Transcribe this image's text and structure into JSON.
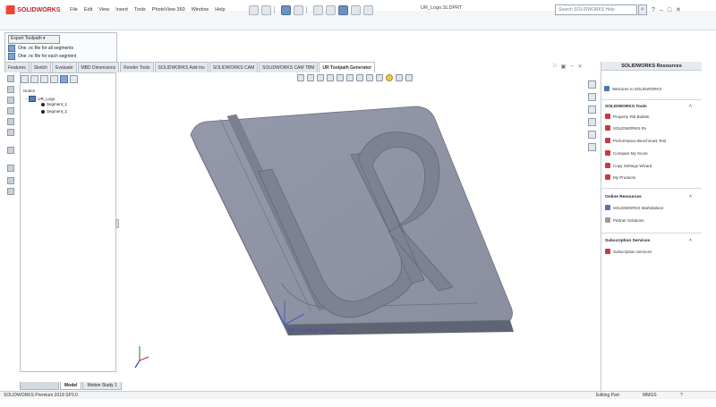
{
  "app": {
    "logo_text": "SOLIDWORKS",
    "menu": [
      "File",
      "Edit",
      "View",
      "Insert",
      "Tools",
      "PhotoView 360",
      "Window",
      "Help"
    ],
    "document_title": "UR_Logo.SLDPRT",
    "search_placeholder": "Search SOLIDWORKS Help"
  },
  "export_menu": {
    "header": "Export Toolpath",
    "options": [
      "One .nc file for all segments",
      "One .nc file for each segment"
    ]
  },
  "tabs": [
    "Features",
    "Sketch",
    "Evaluate",
    "MBD Dimensions",
    "Render Tools",
    "SOLIDWORKS Add-Ins",
    "SOLIDWORKS CAM",
    "SOLIDWORKS CAM TBM",
    "UR Toolpath Generator"
  ],
  "active_tab": "UR Toolpath Generator",
  "feature_tree": {
    "header": "Nodes",
    "root": "UR_Logo",
    "children": [
      "Segment_1",
      "Segment_2"
    ]
  },
  "model": {
    "body_color": "#8e93a3",
    "coord_label": "UR_Coordinate_System"
  },
  "task_pane": {
    "title": "SOLIDWORKS Resources",
    "welcome": "Welcome to SOLIDWORKS",
    "sections": [
      {
        "title": "SOLIDWORKS Tools",
        "items": [
          "Property Tab Builder",
          "SOLIDWORKS Rx",
          "Performance Benchmark Test",
          "Compare My Score",
          "Copy Settings Wizard",
          "My Products"
        ]
      },
      {
        "title": "Online Resources",
        "items": [
          "SOLIDWORKS Marketplace",
          "Partner Solutions"
        ]
      },
      {
        "title": "Subscription Services",
        "items": [
          "Subscription Services"
        ]
      }
    ]
  },
  "bottom_tabs": [
    "Model",
    "Motion Study 1"
  ],
  "status": {
    "left": "SOLIDWORKS Premium 2018 SP3.0",
    "editing": "Editing Part",
    "units": "MMGS"
  }
}
